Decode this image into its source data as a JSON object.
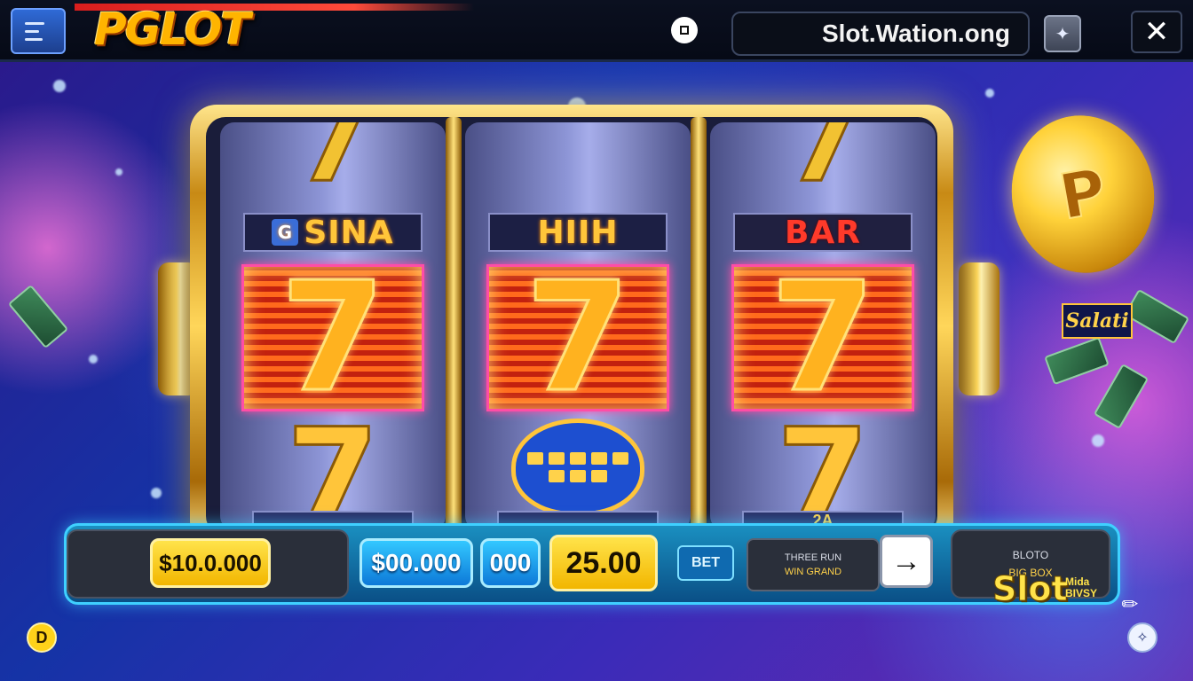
{
  "header": {
    "logo_text": "PGLOT",
    "url": "Slot.Wation.ong",
    "icons": {
      "menu": "menu-icon",
      "record": "record-icon",
      "share": "share-icon",
      "close": "close-icon"
    },
    "close_glyph": "✕",
    "share_glyph": "✦"
  },
  "reels": [
    {
      "top_symbol": "7",
      "label": "SINA",
      "label_badge": "G",
      "label_style": "gold",
      "center_symbol": "7",
      "bottom_symbol": "7",
      "bottom_tab": ""
    },
    {
      "top_symbol": "",
      "label": "HIIH",
      "label_badge": "",
      "label_style": "gold",
      "center_symbol": "7",
      "bottom_symbol": "bubble",
      "bottom_tab": ""
    },
    {
      "top_symbol": "7",
      "label": "BAR",
      "label_badge": "",
      "label_style": "red",
      "center_symbol": "7",
      "bottom_symbol": "7",
      "bottom_tab": "2A"
    }
  ],
  "decor": {
    "coin_text": "P",
    "side_tag": "Salati"
  },
  "controls": {
    "balance": "$10.0.000",
    "bet_amount": "$00.000",
    "lines": "000",
    "win": "25.00",
    "bet_button": "BET",
    "info_line1": "THREE RUN",
    "info_line2": "WIN GRAND",
    "spin_arrow": "→",
    "right_line1": "BLOTO",
    "right_line2": "BIG BOX",
    "brand": "Slot",
    "brand_sub1": "Mida",
    "brand_sub2": "BIVSY",
    "left_circle": "D",
    "right_circle": "✧",
    "pen_glyph": "✎"
  },
  "colors": {
    "accent_gold": "#ffc53a",
    "panel_blue": "#1a8fc0",
    "win_red": "#c2210f"
  }
}
